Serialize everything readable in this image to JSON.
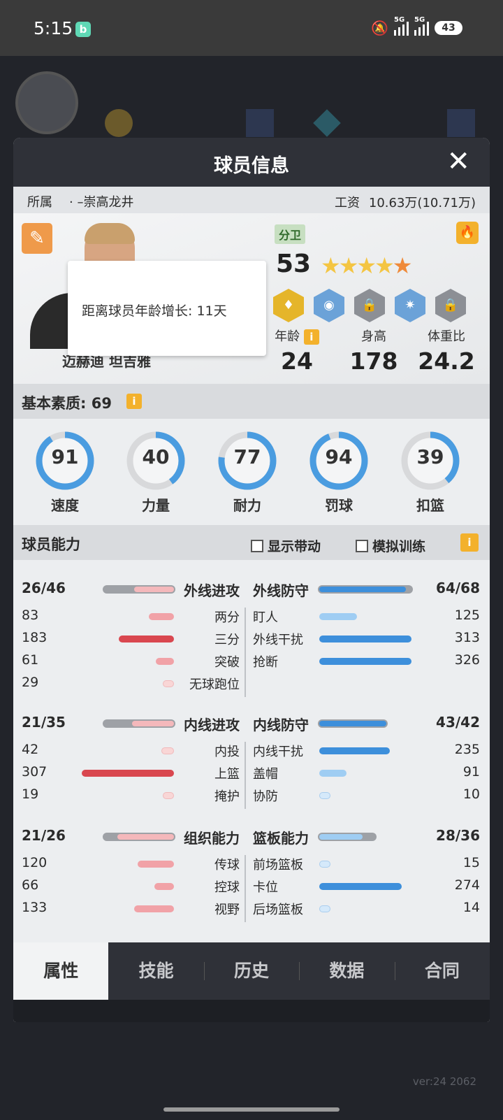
{
  "status": {
    "time": "5:15",
    "battery": "43"
  },
  "background": {
    "version": "ver:24  2062"
  },
  "modal": {
    "title": "球员信息",
    "team_label": "所属",
    "team": "· –崇高龙井",
    "salary_label": "工资",
    "salary": "10.63万(10.71万)"
  },
  "player": {
    "name": "迈赫迪 坦吉雅",
    "position": "分卫",
    "rating": "53",
    "stars": 4.5,
    "tooltip": "距离球员年龄增长: 11天",
    "age_label": "年龄",
    "age": "24",
    "height_label": "身高",
    "height": "178",
    "bmi_label": "体重比",
    "bmi": "24.2"
  },
  "basic": {
    "title": "基本素质: 69",
    "items": [
      {
        "label": "速度",
        "value": "91"
      },
      {
        "label": "力量",
        "value": "40"
      },
      {
        "label": "耐力",
        "value": "77"
      },
      {
        "label": "罚球",
        "value": "94"
      },
      {
        "label": "扣篮",
        "value": "39"
      }
    ]
  },
  "abilities": {
    "title": "球员能力",
    "show_drive": "显示带动",
    "sim_train": "模拟训练",
    "groups": [
      {
        "left_score": "26/46",
        "left_name": "外线进攻",
        "right_name": "外线防守",
        "right_score": "64/68",
        "left_items": [
          {
            "value": "83",
            "name": "两分"
          },
          {
            "value": "183",
            "name": "三分"
          },
          {
            "value": "61",
            "name": "突破"
          },
          {
            "value": "29",
            "name": "无球跑位"
          }
        ],
        "right_items": [
          {
            "name": "盯人",
            "value": "125"
          },
          {
            "name": "外线干扰",
            "value": "313"
          },
          {
            "name": "抢断",
            "value": "326"
          }
        ]
      },
      {
        "left_score": "21/35",
        "left_name": "内线进攻",
        "right_name": "内线防守",
        "right_score": "43/42",
        "left_items": [
          {
            "value": "42",
            "name": "内投"
          },
          {
            "value": "307",
            "name": "上篮"
          },
          {
            "value": "19",
            "name": "掩护"
          }
        ],
        "right_items": [
          {
            "name": "内线干扰",
            "value": "235"
          },
          {
            "name": "盖帽",
            "value": "91"
          },
          {
            "name": "协防",
            "value": "10"
          }
        ]
      },
      {
        "left_score": "21/26",
        "left_name": "组织能力",
        "right_name": "篮板能力",
        "right_score": "28/36",
        "left_items": [
          {
            "value": "120",
            "name": "传球"
          },
          {
            "value": "66",
            "name": "控球"
          },
          {
            "value": "133",
            "name": "视野"
          }
        ],
        "right_items": [
          {
            "name": "前场篮板",
            "value": "15"
          },
          {
            "name": "卡位",
            "value": "274"
          },
          {
            "name": "后场篮板",
            "value": "14"
          }
        ]
      }
    ]
  },
  "tabs": [
    "属性",
    "技能",
    "历史",
    "数据",
    "合同"
  ]
}
